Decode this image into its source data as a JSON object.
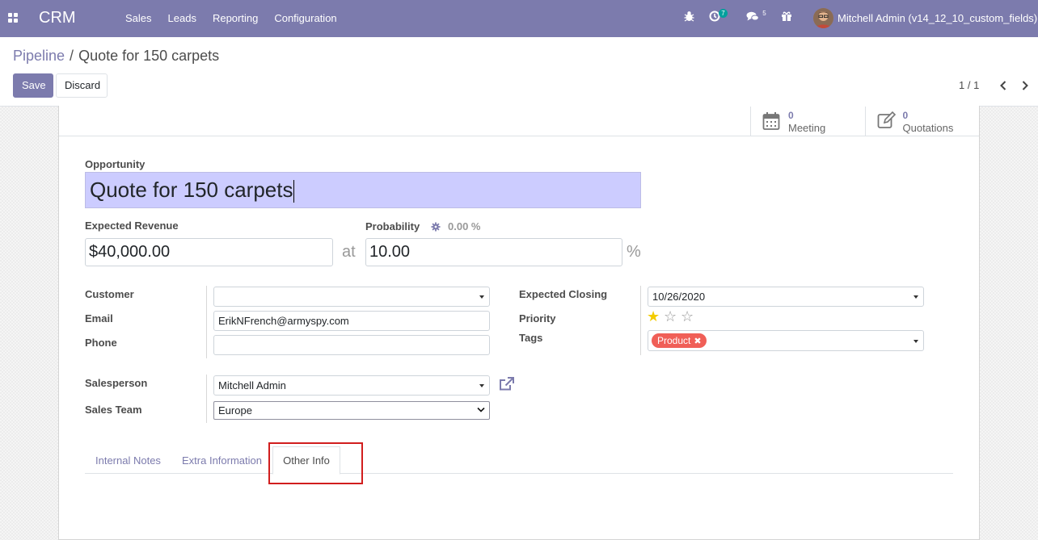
{
  "navbar": {
    "brand": "CRM",
    "menu": [
      "Sales",
      "Leads",
      "Reporting",
      "Configuration"
    ],
    "activity_count": "7",
    "message_count": "5",
    "user": "Mitchell Admin (v14_12_10_custom_fields)"
  },
  "breadcrumb": {
    "parent": "Pipeline",
    "separator": "/",
    "current": "Quote for 150 carpets"
  },
  "actions": {
    "save": "Save",
    "discard": "Discard"
  },
  "pager": {
    "text": "1 / 1"
  },
  "smart_buttons": [
    {
      "value": "0",
      "label": "Meeting",
      "icon": "calendar-icon"
    },
    {
      "value": "0",
      "label": "Quotations",
      "icon": "edit-icon"
    }
  ],
  "form": {
    "opportunity_label": "Opportunity",
    "opportunity_name": "Quote for 150 carpets",
    "expected_revenue_label": "Expected Revenue",
    "expected_revenue": "$40,000.00",
    "at": "at",
    "probability_label": "Probability",
    "automated_probability": "0.00 %",
    "probability": "10.00",
    "percent": "%",
    "customer_label": "Customer",
    "customer": "",
    "email_label": "Email",
    "email": "ErikNFrench@armyspy.com",
    "phone_label": "Phone",
    "phone": "",
    "expected_closing_label": "Expected Closing",
    "expected_closing": "10/26/2020",
    "priority_label": "Priority",
    "priority": 1,
    "priority_max": 3,
    "tags_label": "Tags",
    "tags": [
      "Product"
    ],
    "salesperson_label": "Salesperson",
    "salesperson": "Mitchell Admin",
    "sales_team_label": "Sales Team",
    "sales_team": "Europe"
  },
  "tabs": [
    {
      "label": "Internal Notes",
      "active": false
    },
    {
      "label": "Extra Information",
      "active": false
    },
    {
      "label": "Other Info",
      "active": true
    }
  ],
  "colors": {
    "brand": "#7c7bad",
    "tag": "#f05f57",
    "star_active": "#f3cc00",
    "highlight": "#d11e1e"
  }
}
